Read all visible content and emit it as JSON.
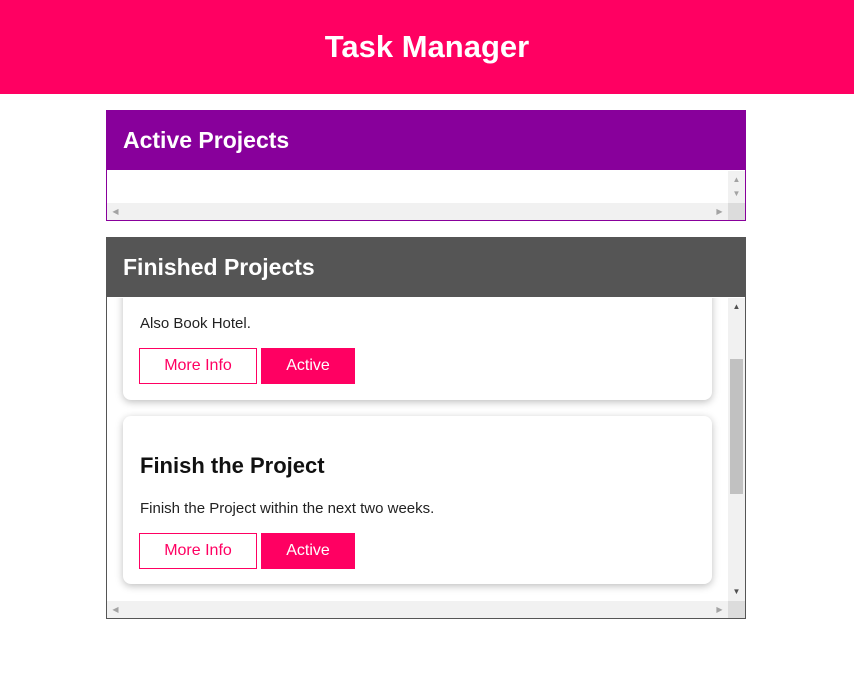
{
  "app": {
    "title": "Task Manager"
  },
  "active_section": {
    "title": "Active Projects",
    "items": []
  },
  "finished_section": {
    "title": "Finished Projects",
    "items": [
      {
        "title": "",
        "description": "Also Book Hotel.",
        "info_label": "More Info",
        "action_label": "Active"
      },
      {
        "title": "Finish the Project",
        "description": "Finish the Project within the next two weeks.",
        "info_label": "More Info",
        "action_label": "Active"
      }
    ]
  },
  "colors": {
    "brand": "#ff0062",
    "active_header": "#88009b",
    "finished_header": "#555555"
  }
}
